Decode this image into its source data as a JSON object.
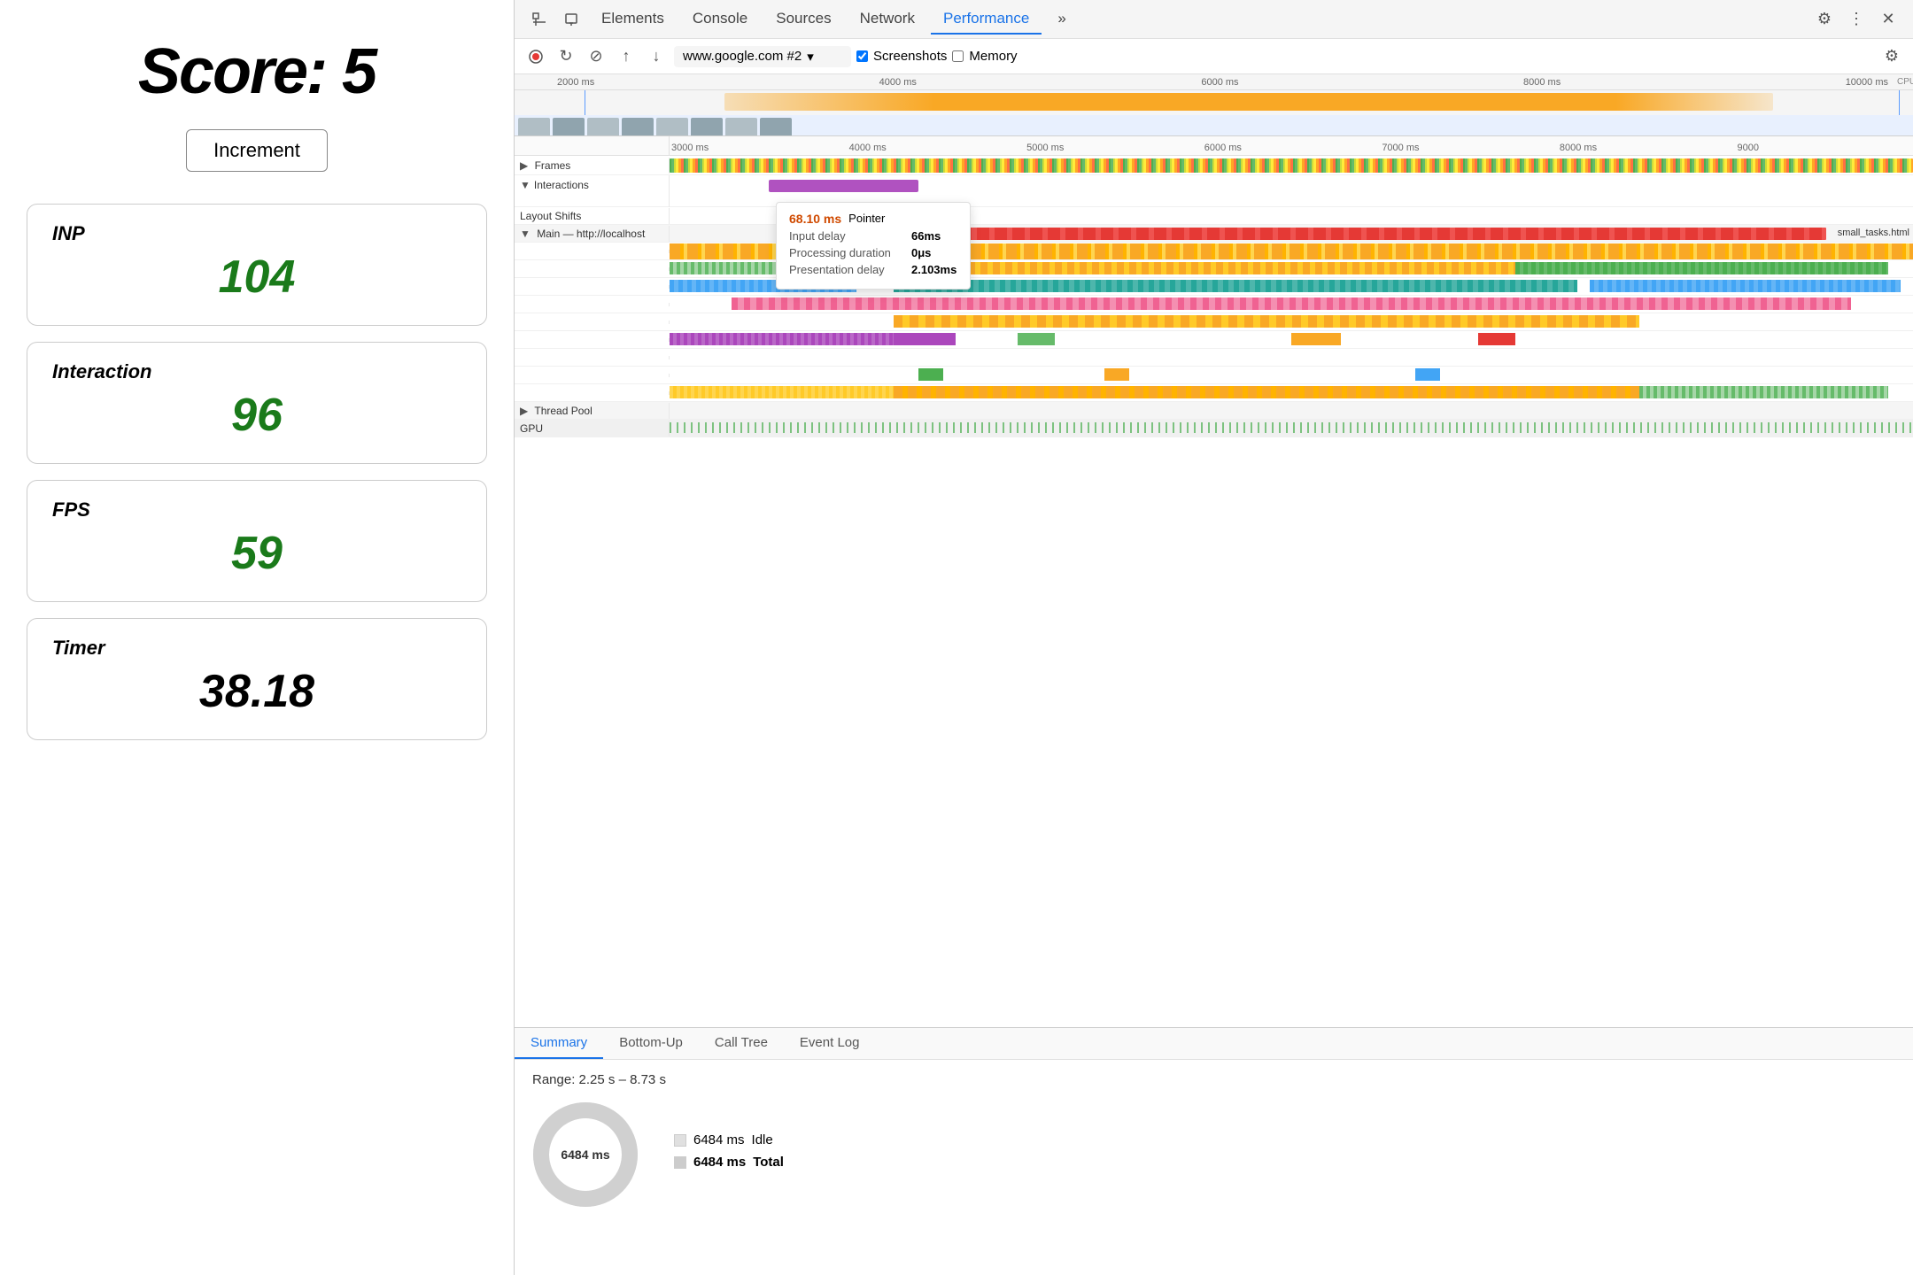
{
  "leftPanel": {
    "scoreLabel": "Score:",
    "scoreValue": "5",
    "incrementBtn": "Increment",
    "metrics": [
      {
        "id": "inp",
        "label": "INP",
        "value": "104",
        "valueStyle": "green"
      },
      {
        "id": "interaction",
        "label": "Interaction",
        "value": "96",
        "valueStyle": "green"
      },
      {
        "id": "fps",
        "label": "FPS",
        "value": "59",
        "valueStyle": "green"
      },
      {
        "id": "timer",
        "label": "Timer",
        "value": "38.18",
        "valueStyle": "black"
      }
    ]
  },
  "devtools": {
    "tabs": [
      {
        "id": "elements",
        "label": "Elements",
        "active": false
      },
      {
        "id": "console",
        "label": "Console",
        "active": false
      },
      {
        "id": "sources",
        "label": "Sources",
        "active": false
      },
      {
        "id": "network",
        "label": "Network",
        "active": false
      },
      {
        "id": "performance",
        "label": "Performance",
        "active": true
      },
      {
        "id": "more",
        "label": "»",
        "active": false
      }
    ],
    "toolbar": {
      "urlLabel": "www.google.com #2",
      "screenshotsLabel": "Screenshots",
      "memoryLabel": "Memory"
    },
    "timelineRuler": {
      "ticks": [
        "3000 ms",
        "4000 ms",
        "5000 ms",
        "6000 ms",
        "7000 ms",
        "8000 ms",
        "9000"
      ]
    },
    "overviewTicks": [
      "2000 ms",
      "4000 ms",
      "6000 ms",
      "8000 ms",
      "10000 ms"
    ],
    "sections": {
      "frames": "Frames",
      "interactions": "Interactions",
      "layoutShifts": "Layout Shifts",
      "main": "Main — http://localhost",
      "threadPool": "Thread Pool",
      "gpu": "GPU"
    },
    "tooltip": {
      "timing": "68.10 ms",
      "type": "Pointer",
      "inputDelayLabel": "Input delay",
      "inputDelayValue": "66ms",
      "processingLabel": "Processing duration",
      "processingValue": "0μs",
      "presentationLabel": "Presentation delay",
      "presentationValue": "2.103ms"
    },
    "mainTask": "small_tasks.html",
    "bottomPanel": {
      "tabs": [
        {
          "id": "summary",
          "label": "Summary",
          "active": true
        },
        {
          "id": "bottom-up",
          "label": "Bottom-Up",
          "active": false
        },
        {
          "id": "call-tree",
          "label": "Call Tree",
          "active": false
        },
        {
          "id": "event-log",
          "label": "Event Log",
          "active": false
        }
      ],
      "range": "Range: 2.25 s – 8.73 s",
      "donut": {
        "centerLabel": "6484 ms",
        "items": [
          {
            "label": "Idle",
            "value": "6484 ms",
            "bold": false
          },
          {
            "label": "Total",
            "value": "6484 ms",
            "bold": true
          }
        ]
      }
    }
  }
}
